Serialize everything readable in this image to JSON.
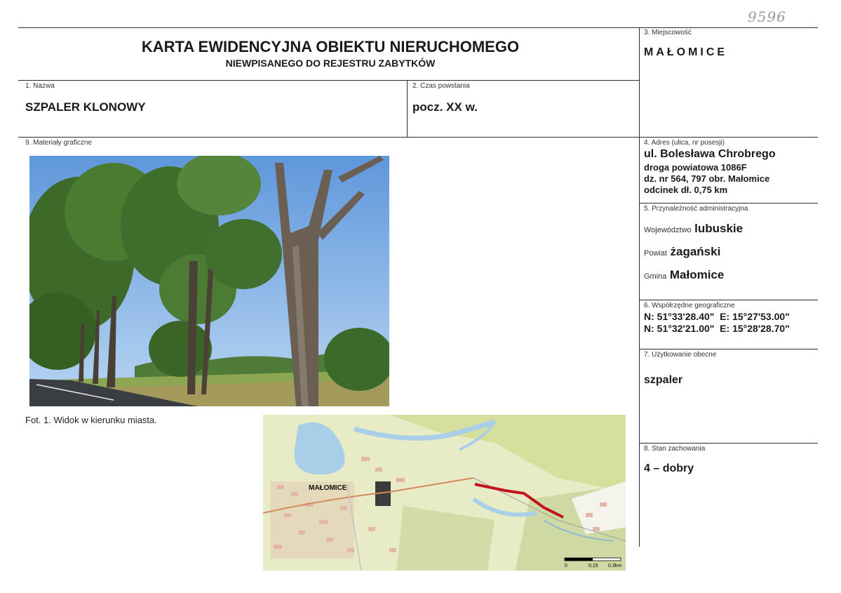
{
  "page_number": "9596",
  "header": {
    "title": "KARTA EWIDENCYJNA OBIEKTU NIERUCHOMEGO",
    "subtitle": "NIEWPISANEGO DO REJESTRU ZABYTKÓW"
  },
  "fields": {
    "nazwa": {
      "label": "1. Nazwa",
      "value": "SZPALER KLONOWY"
    },
    "czas": {
      "label": "2. Czas powstania",
      "value": "pocz. XX w."
    },
    "miejscowosc": {
      "label": "3. Miejscowość",
      "value": "MAŁOMICE"
    },
    "adres": {
      "label": "4. Adres (ulica, nr posesji)",
      "line1": "ul. Bolesława Chrobrego",
      "line2": "droga powiatowa 1086F",
      "line3": "dz. nr 564, 797 obr. Małomice",
      "line4": "odcinek dł. 0,75 km"
    },
    "administracja": {
      "label": "5. Przynależność administracyjna",
      "wojewodztwo_key": "Województwo",
      "wojewodztwo": "lubuskie",
      "powiat_key": "Powiat",
      "powiat": "żagański",
      "gmina_key": "Gmina",
      "gmina": "Małomice"
    },
    "wspolrzedne": {
      "label": "6. Współrzędne geograficzne",
      "line1": "N: 51°33'28.40\"  E: 15°27'53.00\"",
      "line2": "N: 51°32'21.00\"  E: 15°28'28.70\""
    },
    "uzytkowanie": {
      "label": "7. Użytkowanie obecne",
      "value": "szpaler"
    },
    "stan": {
      "label": "8. Stan zachowania",
      "value": "4 – dobry"
    },
    "materialy": {
      "label": "9. Materiały graficzne"
    }
  },
  "photo_caption": "Fot. 1. Widok w kierunku miasta.",
  "map": {
    "town_label": "MAŁOMICE",
    "scale_0": "0",
    "scale_1": "0,15",
    "scale_2": "0,3km"
  },
  "colors": {
    "sky": "#7fb0e6",
    "foliage": "#3f6e2a",
    "route": "#c2151b",
    "map_bg": "#e7ebc6",
    "water": "#a9cfe8"
  }
}
